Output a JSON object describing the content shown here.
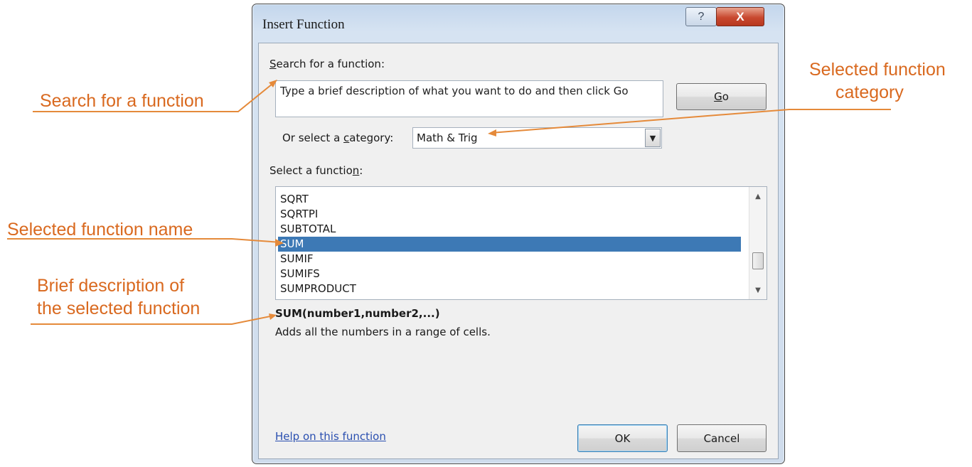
{
  "annotations": {
    "search": "Search for a function",
    "category_line1": "Selected function",
    "category_line2": "category",
    "name": "Selected function name",
    "desc_line1": "Brief description of",
    "desc_line2": "the selected function",
    "color": "#d9691f"
  },
  "window": {
    "title": "Insert Function",
    "help_glyph": "?",
    "close_glyph": "X"
  },
  "search": {
    "label_prefix": "S",
    "label_rest": "earch for a function:",
    "text": "Type a brief description of what you want to do and then click Go",
    "go_prefix": "G",
    "go_rest": "o"
  },
  "category": {
    "label_a": "Or select a ",
    "label_u": "c",
    "label_b": "ategory:",
    "value": "Math & Trig",
    "arrow_icon": "chevron-down-icon"
  },
  "function_list": {
    "label_a": "Select a functio",
    "label_u": "n",
    "label_b": ":",
    "items": [
      "SQRT",
      "SQRTPI",
      "SUBTOTAL",
      "SUM",
      "SUMIF",
      "SUMIFS",
      "SUMPRODUCT"
    ],
    "selected_index": 3
  },
  "selected_function": {
    "signature": "SUM(number1,number2,...)",
    "description": "Adds all the numbers in a range of cells."
  },
  "footer": {
    "help_link": "Help on this function",
    "ok": "OK",
    "cancel": "Cancel"
  }
}
